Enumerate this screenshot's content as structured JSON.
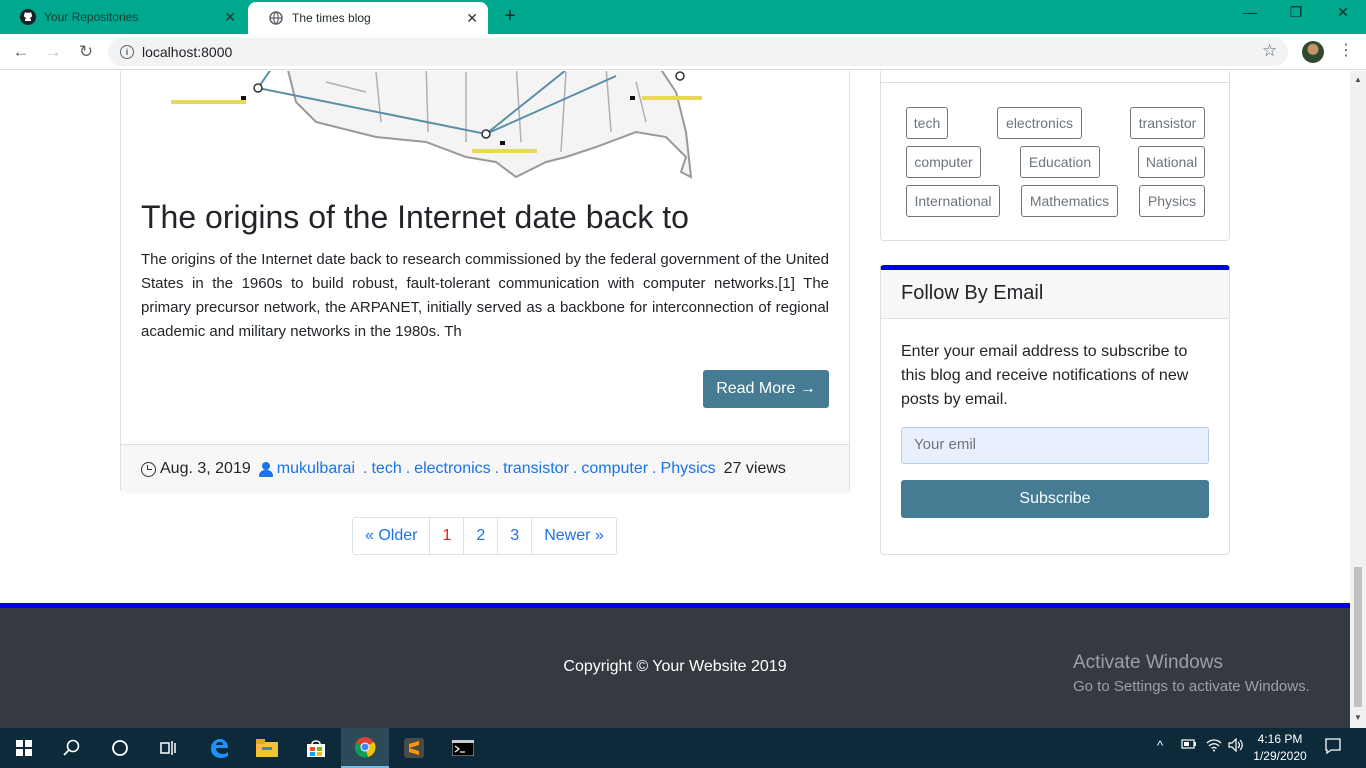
{
  "browser": {
    "tabs": [
      {
        "title": "Your Repositories",
        "active": false
      },
      {
        "title": "The times blog",
        "active": true
      }
    ],
    "url": "localhost:8000"
  },
  "post": {
    "title": "The origins of the Internet date back to",
    "body": "The origins of the Internet date back to research commissioned by the federal government of the United States in the 1960s to build robust, fault-tolerant communication with computer networks.[1] The primary precursor network, the ARPANET, initially served as a backbone for interconnection of regional academic and military networks in the 1980s. Th",
    "read_more": "Read More →",
    "date": "Aug. 3, 2019",
    "author": "mukulbarai",
    "tags": [
      "tech",
      "electronics",
      "transistor",
      "computer",
      "Physics"
    ],
    "views": "27 views"
  },
  "pagination": {
    "older": "« Older",
    "pages": [
      "1",
      "2",
      "3"
    ],
    "current": "1",
    "newer": "Newer »"
  },
  "sidebar": {
    "tags": [
      "tech",
      "electronics",
      "transistor",
      "computer",
      "Education",
      "National",
      "International",
      "Mathematics",
      "Physics"
    ],
    "follow": {
      "title": "Follow By Email",
      "description": "Enter your email address to subscribe to this blog and receive notifications of new posts by email.",
      "placeholder": "Your emil",
      "button": "Subscribe"
    }
  },
  "footer": {
    "copyright": "Copyright © Your Website 2019"
  },
  "watermark": {
    "line1": "Activate Windows",
    "line2": "Go to Settings to activate Windows."
  },
  "taskbar": {
    "time": "4:16 PM",
    "date": "1/29/2020"
  },
  "colors": {
    "accent": "#457b93",
    "tab_strip": "#00a88e",
    "footer_bar": "#0000ee",
    "link": "#1a73e8"
  }
}
